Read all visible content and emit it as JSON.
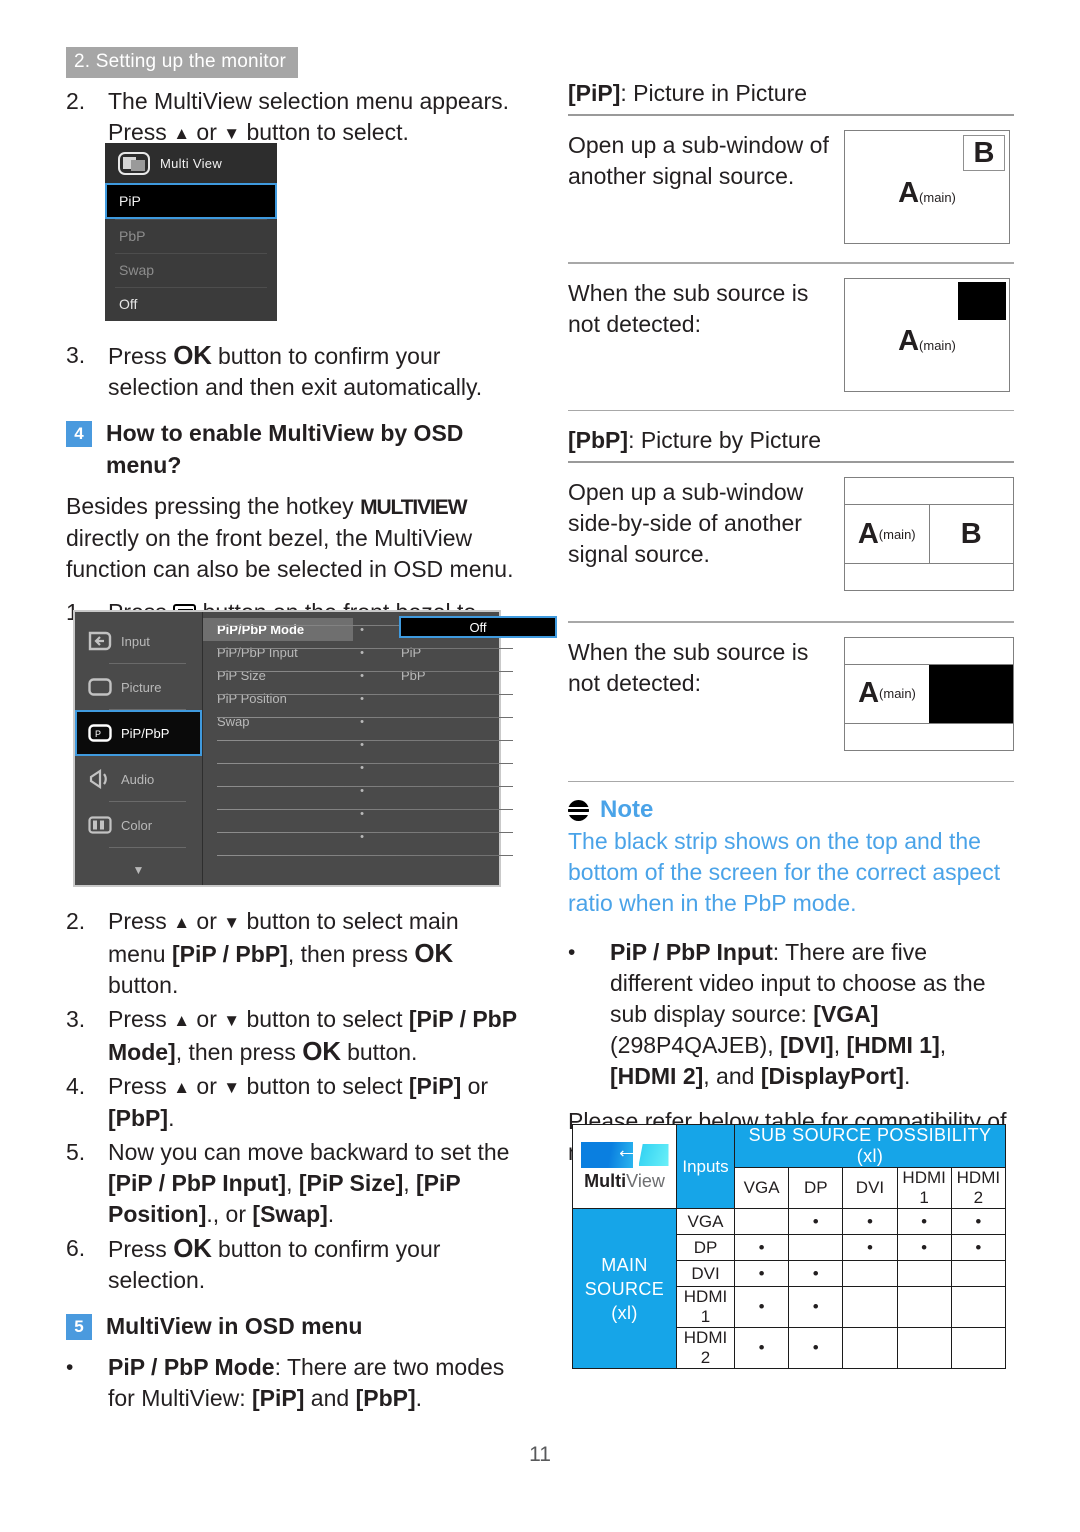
{
  "running_header": "2. Setting up the monitor",
  "page_number": "11",
  "left_column": {
    "step2": {
      "num": "2.",
      "line1": "The MultiView selection menu appears.",
      "line2_pre": "Press ",
      "line2_mid": " or ",
      "line2_post": " button to select."
    },
    "multiview_popup": {
      "title": "Multi View",
      "icon": "multiview-icon",
      "items": [
        {
          "label": "PiP",
          "state": "selected"
        },
        {
          "label": "PbP",
          "state": "dimmed"
        },
        {
          "label": "Swap",
          "state": "dimmed"
        },
        {
          "label": "Off",
          "state": "normal"
        }
      ]
    },
    "step3": {
      "num": "3.",
      "pre": "Press ",
      "ok": "OK",
      "post": " button to confirm your selection and then exit automatically."
    },
    "heading4": {
      "badge": "4",
      "text": "How to enable MultiView by OSD menu?"
    },
    "para_besides": {
      "pre": "Besides pressing the hotkey ",
      "hotkey": "MULTIVIEW",
      "post": " directly on the front bezel, the MultiView function can also be selected in OSD menu."
    },
    "step1_osd": {
      "num": "1.",
      "pre": "Press ",
      "icon": "menu-icon",
      "post": " button on the front bezel to enter OSD Menu Screen."
    },
    "osd_screen": {
      "menu_items": [
        {
          "label": "Input",
          "icon": "input-icon",
          "selected": false
        },
        {
          "label": "Picture",
          "icon": "picture-icon",
          "selected": false
        },
        {
          "label": "PiP/PbP",
          "icon": "pip-icon",
          "selected": true
        },
        {
          "label": "Audio",
          "icon": "audio-icon",
          "selected": false
        },
        {
          "label": "Color",
          "icon": "color-icon",
          "selected": false
        }
      ],
      "scroll_caret": "▼",
      "options": [
        {
          "name": "PiP/PbP Mode",
          "value": "",
          "highlighted": true
        },
        {
          "name": "PiP/PbP Input",
          "value": "PiP",
          "highlighted": false
        },
        {
          "name": "PiP Size",
          "value": "PbP",
          "highlighted": false
        },
        {
          "name": "PiP Position",
          "value": "",
          "highlighted": false
        },
        {
          "name": "Swap",
          "value": "",
          "highlighted": false
        },
        {
          "name": "",
          "value": "",
          "highlighted": false
        },
        {
          "name": "",
          "value": "",
          "highlighted": false
        },
        {
          "name": "",
          "value": "",
          "highlighted": false
        },
        {
          "name": "",
          "value": "",
          "highlighted": false
        },
        {
          "name": "",
          "value": "",
          "highlighted": false
        },
        {
          "name": "",
          "value": "",
          "highlighted": false
        }
      ],
      "selected_value": "Off"
    },
    "step2b": {
      "num": "2.",
      "pre": "Press ",
      "mid": " or ",
      "post": " button to select main menu ",
      "bold": "[PiP / PbP]",
      "tail1": ", then press ",
      "ok": "OK",
      "tail2": " button."
    },
    "step3b": {
      "num": "3.",
      "pre": "Press ",
      "mid": " or ",
      "post": " button to select ",
      "bold": "[PiP / PbP Mode]",
      "tail1": ", then press ",
      "ok": "OK",
      "tail2": " button."
    },
    "step4b": {
      "num": "4.",
      "pre": "Press ",
      "mid": " or ",
      "post": " button to select ",
      "bold1": "[PiP]",
      "conj": " or ",
      "bold2": "[PbP]",
      "tail": "."
    },
    "step5b": {
      "num": "5.",
      "pre": "Now you can move backward to set the ",
      "b1": "[PiP / PbP Input]",
      "s1": ", ",
      "b2": "[PiP Size]",
      "s2": ", ",
      "b3": "[PiP Position]",
      "s3": "., or ",
      "b4": "[Swap]",
      "tail": "."
    },
    "step6b": {
      "num": "6.",
      "pre": "Press ",
      "ok": "OK",
      "post": " button to confirm your selection."
    },
    "heading5": {
      "badge": "5",
      "text": "MultiView in OSD menu"
    },
    "bullet_mode": {
      "dot": "•",
      "bold": "PiP / PbP Mode",
      "text": ": There are two modes for MultiView: ",
      "b1": "[PiP]",
      "conj": " and ",
      "b2": "[PbP]",
      "tail": "."
    }
  },
  "right_column": {
    "pip_heading": {
      "bold": "[PiP]",
      "rest": ": Picture in Picture"
    },
    "pip_block1": {
      "caption": "Open up a sub-window of another signal source.",
      "figure": {
        "sub_label": "B",
        "main_label": "A",
        "main_sub": "(main)"
      }
    },
    "pip_block2": {
      "caption": "When the sub source is not detected:",
      "figure": {
        "sub_label": "",
        "main_label": "A",
        "main_sub": "(main)"
      }
    },
    "pbp_heading": {
      "bold": "[PbP]",
      "rest": ": Picture by Picture"
    },
    "pbp_block1": {
      "caption": "Open up a sub-window side-by-side of another signal source.",
      "figure": {
        "left_label": "A",
        "left_sub": "(main)",
        "right_label": "B"
      }
    },
    "pbp_block2": {
      "caption": "When the sub source is not detected:",
      "figure": {
        "left_label": "A",
        "left_sub": "(main)",
        "right_label": ""
      }
    },
    "note": {
      "icon": "note-icon",
      "title": "Note",
      "body": "The black strip shows on the top and the bottom of the screen for the correct aspect ratio when in the PbP mode."
    },
    "bullet_input": {
      "dot": "•",
      "bold": "PiP / PbP Input",
      "t1": ": There are five different video input to choose as the sub display source: ",
      "b1": "[VGA]",
      "t2": " (298P4QAJEB), ",
      "b2": "[DVI]",
      "t3": ", ",
      "b3": "[HDMI 1]",
      "t4": ", ",
      "b4": "[HDMI 2]",
      "t5": ", and ",
      "b5": "[DisplayPort]",
      "t6": "."
    },
    "refer_text": "Please refer below table for compatibility of main/sub input source.",
    "compat_table": {
      "logo_word_bold": "Multi",
      "logo_word_light": "View",
      "sub_header": "SUB SOURCE POSSIBILITY (xl)",
      "inputs_label": "Inputs",
      "main_source_label": "MAIN SOURCE",
      "main_source_sub": "(xl)",
      "columns": [
        "VGA",
        "DP",
        "DVI",
        "HDMI 1",
        "HDMI 2"
      ],
      "rows": [
        {
          "label": "VGA",
          "cells": [
            "",
            "•",
            "•",
            "•",
            "•"
          ]
        },
        {
          "label": "DP",
          "cells": [
            "•",
            "",
            "•",
            "•",
            "•"
          ]
        },
        {
          "label": "DVI",
          "cells": [
            "•",
            "•",
            "",
            "",
            ""
          ]
        },
        {
          "label": "HDMI 1",
          "cells": [
            "•",
            "•",
            "",
            "",
            ""
          ]
        },
        {
          "label": "HDMI 2",
          "cells": [
            "•",
            "•",
            "",
            "",
            ""
          ]
        }
      ]
    }
  },
  "colors": {
    "accent_blue": "#4a9ade",
    "table_blue": "#16a5e8",
    "note_blue": "#4aa3e8",
    "header_gray": "#a6a6a6"
  }
}
